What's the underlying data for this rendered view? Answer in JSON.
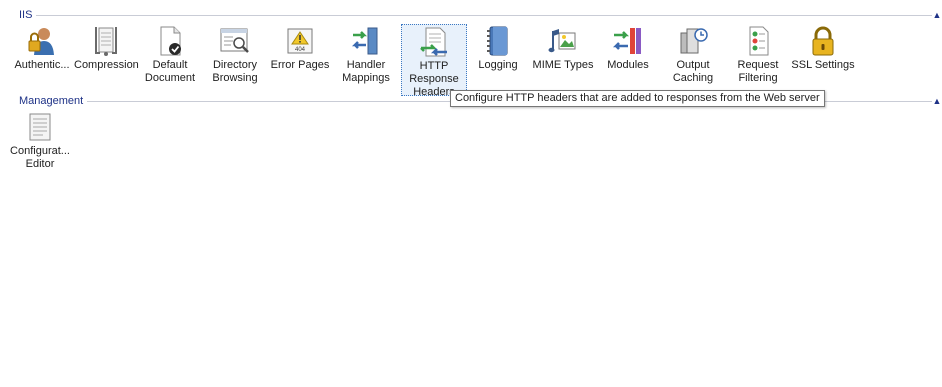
{
  "groups": {
    "iis": {
      "title": "IIS"
    },
    "management": {
      "title": "Management"
    }
  },
  "features": {
    "authentication": {
      "label": "Authentic...",
      "icon": "user-lock-icon"
    },
    "compression": {
      "label": "Compression",
      "icon": "compression-clamp-icon"
    },
    "default_document": {
      "label": "Default\nDocument",
      "icon": "default-document-icon"
    },
    "directory_browsing": {
      "label": "Directory\nBrowsing",
      "icon": "directory-browsing-icon"
    },
    "error_pages": {
      "label": "Error Pages",
      "icon": "error-404-icon"
    },
    "handler_mappings": {
      "label": "Handler\nMappings",
      "icon": "handler-mappings-icon"
    },
    "http_response_headers": {
      "label": "HTTP\nResponse\nHeaders",
      "icon": "http-headers-icon"
    },
    "logging": {
      "label": "Logging",
      "icon": "logbook-icon"
    },
    "mime_types": {
      "label": "MIME Types",
      "icon": "mime-types-icon"
    },
    "modules": {
      "label": "Modules",
      "icon": "modules-icon"
    },
    "output_caching": {
      "label": "Output\nCaching",
      "icon": "output-caching-icon"
    },
    "request_filtering": {
      "label": "Request\nFiltering",
      "icon": "request-filtering-icon"
    },
    "ssl_settings": {
      "label": "SSL Settings",
      "icon": "padlock-icon"
    },
    "configuration_editor": {
      "label": "Configurat...\nEditor",
      "icon": "configuration-editor-icon"
    }
  },
  "tooltip": {
    "text": "Configure HTTP headers that are added to responses from the Web server"
  }
}
